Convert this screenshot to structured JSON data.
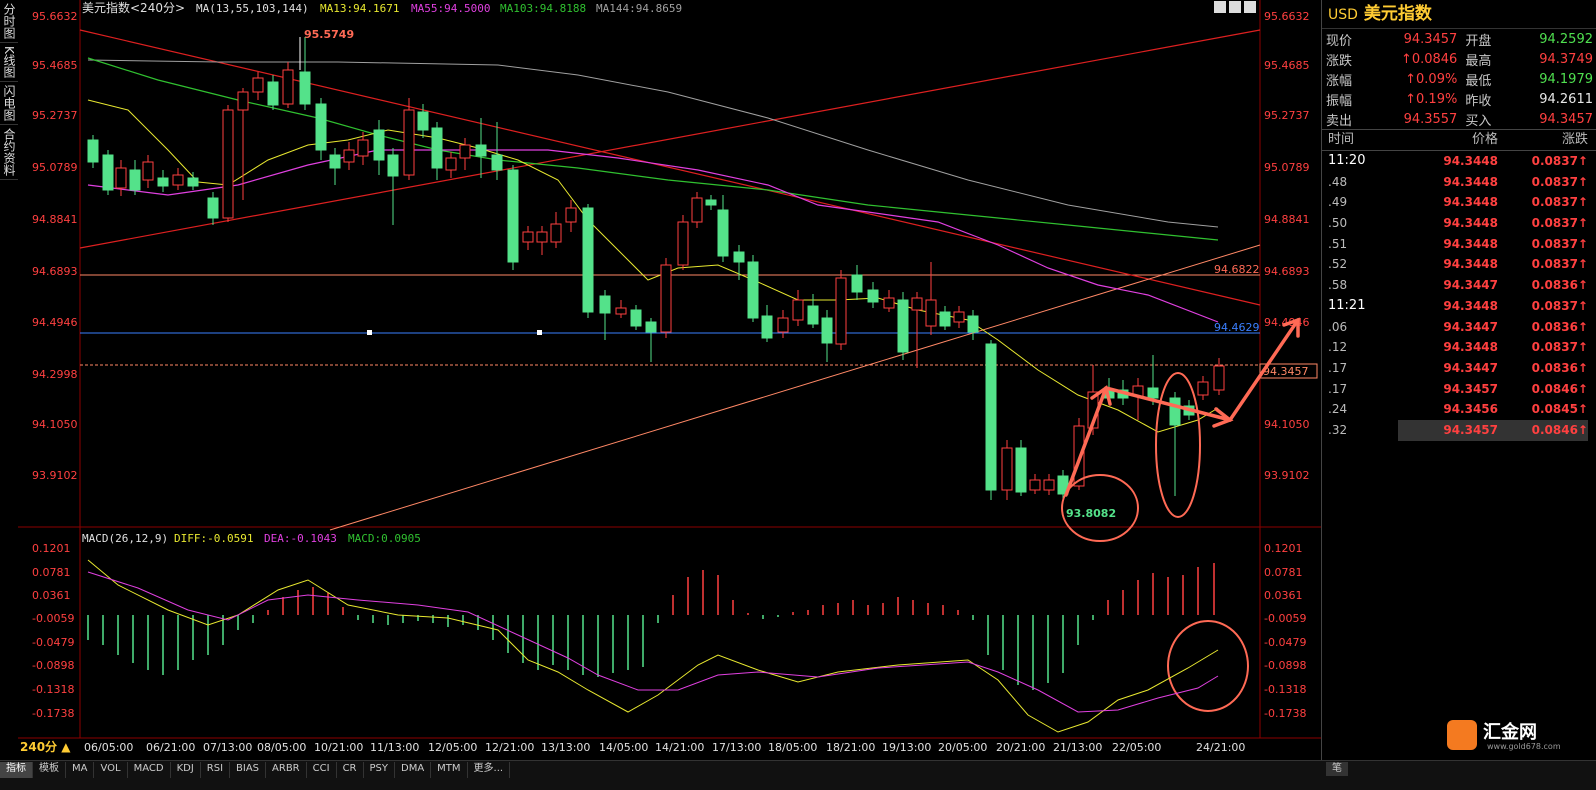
{
  "left_tabs": [
    "分时图",
    "K线图",
    "闪电图",
    "合约资料"
  ],
  "header": {
    "symbol": "美元指数",
    "period": "<240分>",
    "ma_label": "MA(13,55,103,144)",
    "ma13": "MA13:94.1671",
    "ma55": "MA55:94.5000",
    "ma103": "MA103:94.8188",
    "ma144": "MA144:94.8659"
  },
  "price_axis": [
    "95.6632",
    "95.4685",
    "95.2737",
    "95.0789",
    "94.8841",
    "94.6893",
    "94.4946",
    "94.2998",
    "94.1050",
    "93.9102"
  ],
  "macd_axis": [
    "0.1201",
    "0.0781",
    "0.0361",
    "-0.0059",
    "-0.0479",
    "-0.0898",
    "-0.1318",
    "-0.1738"
  ],
  "macd_header": {
    "label": "MACD(26,12,9)",
    "diff": "DIFF:-0.0591",
    "dea": "DEA:-0.1043",
    "macd": "MACD:0.0905"
  },
  "annotations": {
    "high": "95.5749",
    "low": "93.8082",
    "level1": "94.6822",
    "level2": "94.4629",
    "current": "94.3457",
    "level2_right": "94.4946"
  },
  "time_axis": [
    "06/05:00",
    "06/21:00",
    "07/13:00",
    "08/05:00",
    "10/21:00",
    "11/13:00",
    "12/05:00",
    "12/21:00",
    "13/13:00",
    "14/05:00",
    "14/21:00",
    "17/13:00",
    "18/05:00",
    "18/21:00",
    "19/13:00",
    "20/05:00",
    "20/21:00",
    "21/13:00",
    "22/05:00",
    "24/21:00"
  ],
  "period_selector": "240分 ▲",
  "bottom_tabs": [
    "指标",
    "模板",
    "MA",
    "VOL",
    "MACD",
    "KDJ",
    "RSI",
    "BIAS",
    "ARBR",
    "CCI",
    "CR",
    "PSY",
    "DMA",
    "MTM",
    "更多..."
  ],
  "bottom_right_tab": "笔",
  "quote": {
    "code": "USD",
    "name": "美元指数",
    "rows": [
      {
        "l1": "现价",
        "v1": "94.3457",
        "l2": "开盘",
        "v2": "94.2592"
      },
      {
        "l1": "涨跌",
        "v1": "↑0.0846",
        "l2": "最高",
        "v2": "94.3749"
      },
      {
        "l1": "涨幅",
        "v1": "↑0.09%",
        "l2": "最低",
        "v2": "94.1979"
      },
      {
        "l1": "振幅",
        "v1": "↑0.19%",
        "l2": "昨收",
        "v2": "94.2611"
      },
      {
        "l1": "卖出",
        "v1": "94.3557",
        "l2": "买入",
        "v2": "94.3457"
      }
    ],
    "tick_header": {
      "time": "时间",
      "price": "价格",
      "change": "涨跌"
    },
    "ticks": [
      {
        "t": "11:20",
        "p": "94.3448",
        "c": "0.0837↑",
        "hour": true
      },
      {
        "t": ".48",
        "p": "94.3448",
        "c": "0.0837↑"
      },
      {
        "t": ".49",
        "p": "94.3448",
        "c": "0.0837↑"
      },
      {
        "t": ".50",
        "p": "94.3448",
        "c": "0.0837↑"
      },
      {
        "t": ".51",
        "p": "94.3448",
        "c": "0.0837↑"
      },
      {
        "t": ".52",
        "p": "94.3448",
        "c": "0.0837↑"
      },
      {
        "t": ".58",
        "p": "94.3447",
        "c": "0.0836↑"
      },
      {
        "t": "11:21",
        "p": "94.3448",
        "c": "0.0837↑",
        "hour": true
      },
      {
        "t": ".06",
        "p": "94.3447",
        "c": "0.0836↑"
      },
      {
        "t": ".12",
        "p": "94.3448",
        "c": "0.0837↑"
      },
      {
        "t": ".17",
        "p": "94.3447",
        "c": "0.0836↑"
      },
      {
        "t": ".17",
        "p": "94.3457",
        "c": "0.0846↑"
      },
      {
        "t": ".24",
        "p": "94.3456",
        "c": "0.0845↑"
      },
      {
        "t": ".32",
        "p": "94.3457",
        "c": "0.0846↑",
        "sel": true
      }
    ]
  },
  "logo": {
    "name": "汇金网",
    "url": "www.gold678.com"
  },
  "colors": {
    "up": "#ff4040",
    "down": "#54e28a",
    "ma13": "#e8e830",
    "ma55": "#e040e0",
    "ma103": "#30c030",
    "ma144": "#a0a0a0",
    "trend": "#dd2020",
    "support": "#ff8866",
    "annot": "#ff6a55"
  }
}
